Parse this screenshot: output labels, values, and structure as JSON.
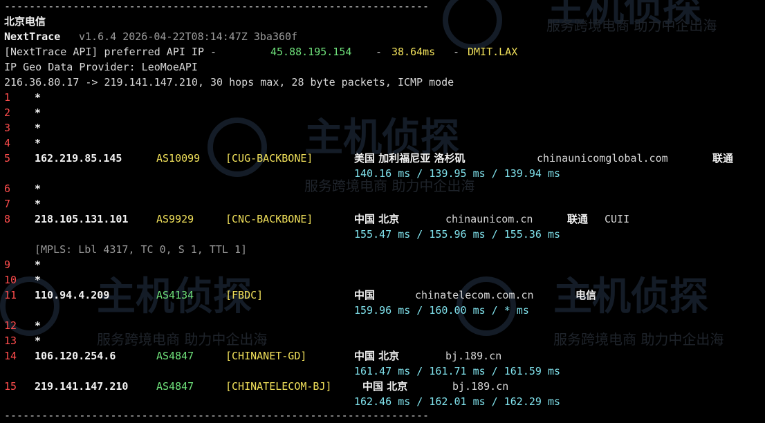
{
  "header": {
    "separator": "--------------------------------------------------------------------",
    "location": "北京电信",
    "app_name": "NextTrace",
    "version_info": "v1.6.4 2026-04-22T08:14:47Z 3ba360f",
    "api_prefix": "[NextTrace API] preferred API IP - ",
    "api_ip": "45.88.195.154",
    "api_dash1": " - ",
    "api_latency": "38.64ms",
    "api_dash2": " - ",
    "api_node": "DMIT.LAX",
    "geo_provider": "IP Geo Data Provider: LeoMoeAPI",
    "route_summary": "216.36.80.17 -> 219.141.147.210, 30 hops max, 28 byte packets, ICMP mode"
  },
  "hops": [
    {
      "n": "1",
      "star": "*"
    },
    {
      "n": "2",
      "star": "*"
    },
    {
      "n": "3",
      "star": "*"
    },
    {
      "n": "4",
      "star": "*"
    },
    {
      "n": "5",
      "ip": "162.219.85.145",
      "asn": "AS10099",
      "tag": "[CUG-BACKBONE]",
      "geo": "美国 加利福尼亚 洛杉矶",
      "domain": "chinaunicomglobal.com",
      "isp": "联通",
      "rtt": "140.16 ms / 139.95 ms / 139.94 ms"
    },
    {
      "n": "6",
      "star": "*"
    },
    {
      "n": "7",
      "star": "*"
    },
    {
      "n": "8",
      "ip": "218.105.131.101",
      "asn": "AS9929",
      "tag": "[CNC-BACKBONE]",
      "geo": "中国 北京",
      "domain": "chinaunicom.cn",
      "isp": "联通",
      "isp_extra": "CUII",
      "rtt": "155.47 ms / 155.96 ms / 155.36 ms",
      "mpls": "[MPLS: Lbl 4317, TC 0, S 1, TTL 1]"
    },
    {
      "n": "9",
      "star": "*"
    },
    {
      "n": "10",
      "star": "*"
    },
    {
      "n": "11",
      "ip": "110.94.4.209",
      "asn": "AS4134",
      "tag": "[FBDC]",
      "geo": "中国",
      "domain": "chinatelecom.com.cn",
      "isp": "电信",
      "rtt": "159.96 ms / 160.00 ms / * ms"
    },
    {
      "n": "12",
      "star": "*"
    },
    {
      "n": "13",
      "star": "*"
    },
    {
      "n": "14",
      "ip": "106.120.254.6",
      "asn": "AS4847",
      "tag": "[CHINANET-GD]",
      "geo": "中国 北京",
      "domain": "bj.189.cn",
      "rtt": "161.47 ms / 161.71 ms / 161.59 ms"
    },
    {
      "n": "15",
      "ip": "219.141.147.210",
      "asn": "AS4847",
      "tag": "[CHINATELECOM-BJ]",
      "geo": "中国 北京",
      "domain": "bj.189.cn",
      "rtt": "162.46 ms / 162.01 ms / 162.29 ms"
    }
  ],
  "watermark": {
    "brand": "主机侦探",
    "slogan": "服务跨境电商 助力中企出海"
  },
  "colors": {
    "background": "#000000",
    "green": "#6ee07a",
    "yellow": "#f0e05a",
    "cyan": "#7fe0ea",
    "hop_number": "#ff4d4d"
  }
}
